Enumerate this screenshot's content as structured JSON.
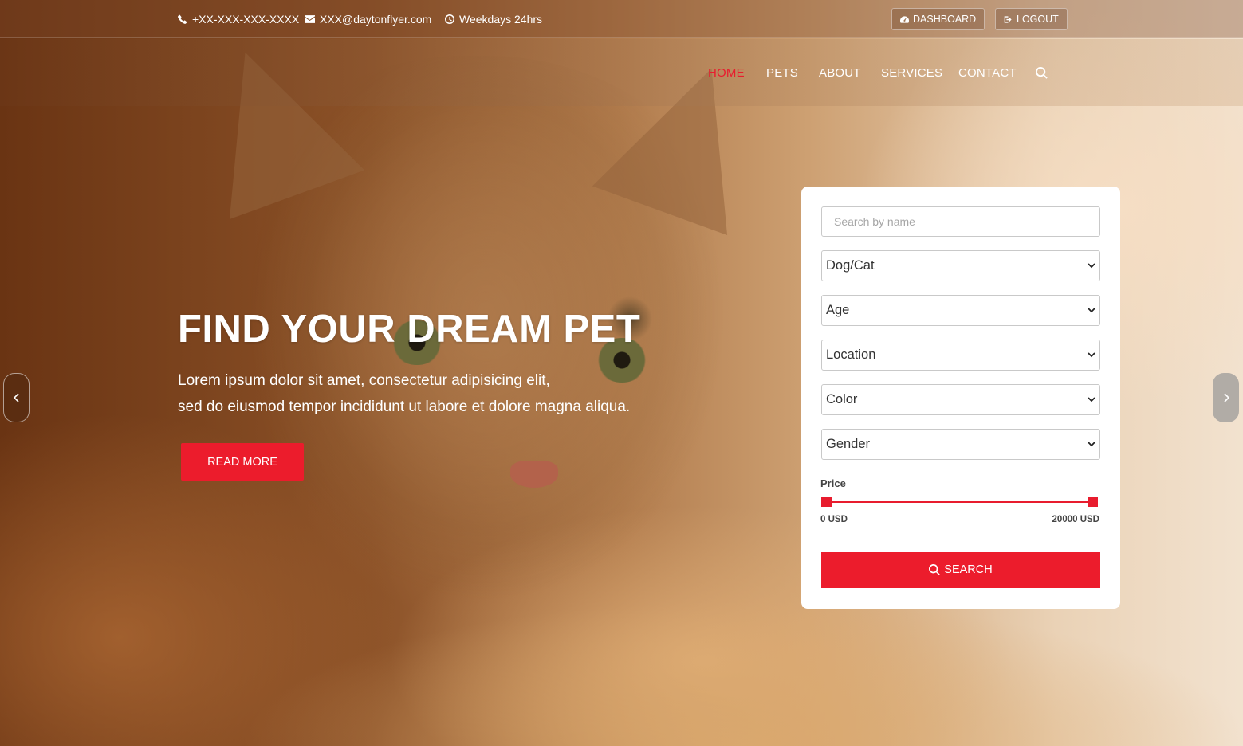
{
  "topbar": {
    "phone": "+XX-XXX-XXX-XXXX",
    "email": "XXX@daytonflyer.com",
    "hours": "Weekdays 24hrs",
    "dashboard_label": "DASHBOARD",
    "logout_label": "LOGOUT"
  },
  "nav": {
    "items": [
      "HOME",
      "PETS",
      "ABOUT",
      "SERVICES",
      "CONTACT"
    ],
    "active": "HOME"
  },
  "hero": {
    "title": "FIND YOUR DREAM PET",
    "subtitle_line1": "Lorem ipsum dolor sit amet, consectetur adipisicing elit,",
    "subtitle_line2": "sed do eiusmod tempor incididunt ut labore et dolore magna aliqua.",
    "read_more_label": "READ MORE"
  },
  "search_panel": {
    "name_placeholder": "Search by name",
    "selects": {
      "type": "Dog/Cat",
      "age": "Age",
      "location": "Location",
      "color": "Color",
      "gender": "Gender"
    },
    "price_label": "Price",
    "price_min": "0 USD",
    "price_max": "20000 USD",
    "search_label": "SEARCH"
  },
  "colors": {
    "accent": "#ec1c2c"
  }
}
